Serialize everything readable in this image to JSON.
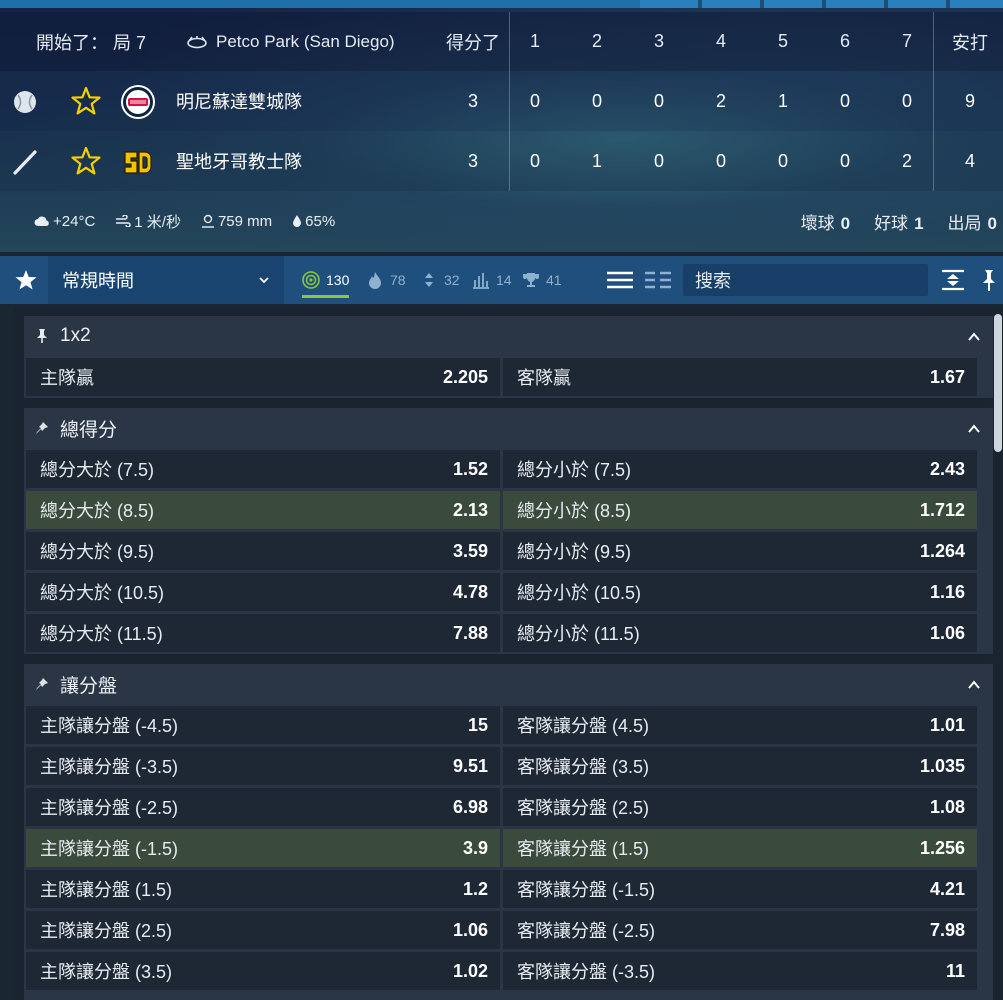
{
  "scoreboard": {
    "status": "開始了： 局 7",
    "venue": "Petco Park (San Diego)",
    "columns": [
      "得分了",
      "1",
      "2",
      "3",
      "4",
      "5",
      "6",
      "7",
      "安打"
    ],
    "teams": [
      {
        "name": "明尼蘇達雙城隊",
        "logo": "twins-logo",
        "icon": "baseball-icon",
        "runs": "3",
        "innings": [
          "0",
          "0",
          "0",
          "2",
          "1",
          "0",
          "0"
        ],
        "hits": "9"
      },
      {
        "name": "聖地牙哥教士隊",
        "logo": "padres-logo",
        "icon": "bat-icon",
        "runs": "3",
        "innings": [
          "0",
          "1",
          "0",
          "0",
          "0",
          "0",
          "2"
        ],
        "hits": "4"
      }
    ],
    "weather": {
      "temp": "+24°C",
      "wind": "1 米/秒",
      "pressure": "759 mm",
      "humidity": "65%"
    },
    "counts": [
      {
        "label": "壞球",
        "value": "0"
      },
      {
        "label": "好球",
        "value": "1"
      },
      {
        "label": "出局",
        "value": "0"
      }
    ]
  },
  "toolbar": {
    "period": "常規時間",
    "tabs": [
      {
        "icon": "target-icon",
        "count": "130",
        "active": true
      },
      {
        "icon": "fire-icon",
        "count": "78"
      },
      {
        "icon": "sort-icon",
        "count": "32"
      },
      {
        "icon": "stats-icon",
        "count": "14"
      },
      {
        "icon": "trophy-icon",
        "count": "41"
      }
    ],
    "search_placeholder": "搜索"
  },
  "markets": [
    {
      "title": "1x2",
      "rows": [
        [
          {
            "label": "主隊贏",
            "odds": "2.205"
          },
          {
            "label": "客隊贏",
            "odds": "1.67"
          }
        ]
      ]
    },
    {
      "title": "總得分",
      "rows": [
        [
          {
            "label": "總分大於 (7.5)",
            "odds": "1.52"
          },
          {
            "label": "總分小於 (7.5)",
            "odds": "2.43"
          }
        ],
        [
          {
            "label": "總分大於 (8.5)",
            "odds": "2.13",
            "hl": true
          },
          {
            "label": "總分小於 (8.5)",
            "odds": "1.712",
            "hl": true
          }
        ],
        [
          {
            "label": "總分大於 (9.5)",
            "odds": "3.59"
          },
          {
            "label": "總分小於 (9.5)",
            "odds": "1.264"
          }
        ],
        [
          {
            "label": "總分大於 (10.5)",
            "odds": "4.78"
          },
          {
            "label": "總分小於 (10.5)",
            "odds": "1.16"
          }
        ],
        [
          {
            "label": "總分大於 (11.5)",
            "odds": "7.88"
          },
          {
            "label": "總分小於 (11.5)",
            "odds": "1.06"
          }
        ]
      ]
    },
    {
      "title": "讓分盤",
      "rows": [
        [
          {
            "label": "主隊讓分盤 (-4.5)",
            "odds": "15"
          },
          {
            "label": "客隊讓分盤 (4.5)",
            "odds": "1.01"
          }
        ],
        [
          {
            "label": "主隊讓分盤 (-3.5)",
            "odds": "9.51"
          },
          {
            "label": "客隊讓分盤 (3.5)",
            "odds": "1.035"
          }
        ],
        [
          {
            "label": "主隊讓分盤 (-2.5)",
            "odds": "6.98"
          },
          {
            "label": "客隊讓分盤 (2.5)",
            "odds": "1.08"
          }
        ],
        [
          {
            "label": "主隊讓分盤 (-1.5)",
            "odds": "3.9",
            "hl": true
          },
          {
            "label": "客隊讓分盤 (1.5)",
            "odds": "1.256",
            "hl": true
          }
        ],
        [
          {
            "label": "主隊讓分盤 (1.5)",
            "odds": "1.2"
          },
          {
            "label": "客隊讓分盤 (-1.5)",
            "odds": "4.21"
          }
        ],
        [
          {
            "label": "主隊讓分盤 (2.5)",
            "odds": "1.06"
          },
          {
            "label": "客隊讓分盤 (-2.5)",
            "odds": "7.98"
          }
        ],
        [
          {
            "label": "主隊讓分盤 (3.5)",
            "odds": "1.02"
          },
          {
            "label": "客隊讓分盤 (-3.5)",
            "odds": "11"
          }
        ]
      ]
    }
  ],
  "colors": {
    "accent": "#8dc63f",
    "toolbar": "#1f4f7d",
    "star": "#f5d000",
    "highlight": "#3a4a3c"
  }
}
